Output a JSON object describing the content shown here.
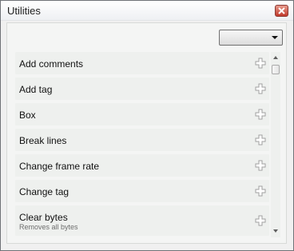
{
  "window": {
    "title": "Utilities"
  },
  "dropdown": {
    "selected": ""
  },
  "items": [
    {
      "label": "Add comments",
      "description": ""
    },
    {
      "label": "Add tag",
      "description": ""
    },
    {
      "label": "Box",
      "description": ""
    },
    {
      "label": "Break lines",
      "description": ""
    },
    {
      "label": "Change frame rate",
      "description": ""
    },
    {
      "label": "Change tag",
      "description": ""
    },
    {
      "label": "Clear bytes",
      "description": "Removes all bytes"
    }
  ],
  "icons": {
    "add": "plus-icon",
    "close": "close-icon"
  },
  "colors": {
    "close_button": "#c0392b",
    "item_background": "#eef0ee",
    "panel_background": "#f4f5f4"
  }
}
